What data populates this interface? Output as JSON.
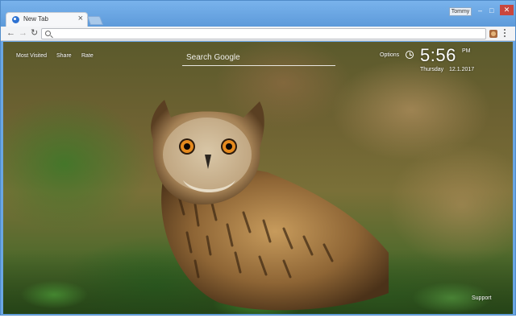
{
  "browser": {
    "tab_title": "New Tab",
    "tab_close": "×",
    "profile_name": "Tommy",
    "window_controls": {
      "minimize": "–",
      "maximize": "□",
      "close": "✕"
    },
    "nav": {
      "back": "←",
      "forward": "→",
      "reload": "↻"
    },
    "omnibox_value": "",
    "accent_color": "#6aa6e3"
  },
  "newtab": {
    "links": [
      "Most Visited",
      "Share",
      "Rate"
    ],
    "search_placeholder": "Search Google",
    "options_label": "Options",
    "time": "5:56",
    "ampm": "PM",
    "day": "Thursday",
    "date": "12.1.2017",
    "support_label": "Support",
    "background_subject": "owl"
  }
}
